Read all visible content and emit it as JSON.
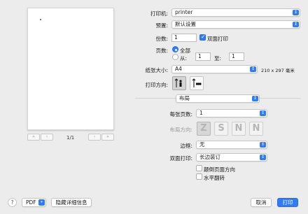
{
  "preview": {
    "page_indicator": "1/1",
    "first_page": "«",
    "prev_page": "‹",
    "next_page": "›",
    "last_page": "»"
  },
  "printer": {
    "label": "打印机:",
    "value": "printer"
  },
  "presets": {
    "label": "预置:",
    "value": "默认设置"
  },
  "copies": {
    "label": "份数:",
    "value": "1",
    "duplex_label": "双面打印",
    "duplex_checked": true
  },
  "pages": {
    "label": "页数:",
    "all_label": "全部",
    "from_label": "从:",
    "from_value": "1",
    "to_label": "至:",
    "to_value": "1"
  },
  "paper_size": {
    "label": "纸张大小:",
    "value": "A4",
    "dimensions": "210 x 297 毫米"
  },
  "orientation": {
    "label": "打印方向:",
    "selected": "portrait"
  },
  "section": {
    "value": "布局"
  },
  "layout": {
    "pages_per_sheet_label": "每张页数:",
    "pages_per_sheet_value": "1",
    "direction_label": "布局方向:",
    "direction_glyphs": [
      "Z",
      "S",
      "N",
      "N"
    ],
    "border_label": "边框:",
    "border_value": "无",
    "two_sided_label": "双面打印:",
    "two_sided_value": "长边装订",
    "reverse_label": "颠倒页面方向",
    "reverse_checked": false,
    "flip_label": "水平翻转",
    "flip_checked": false
  },
  "footer": {
    "help": "?",
    "pdf_label": "PDF",
    "hide_details": "隐藏详细信息",
    "cancel": "取消",
    "print": "打印"
  },
  "colors": {
    "accent": "#2f7cf6",
    "window_bg": "#ececec"
  }
}
